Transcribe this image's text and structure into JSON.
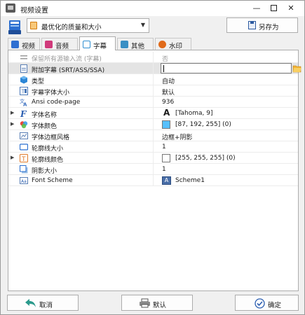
{
  "window": {
    "title": "视频设置"
  },
  "toolbar": {
    "preset_value": "最优化的质量和大小",
    "saveas_label": "另存为"
  },
  "tabs": [
    {
      "label": "视频",
      "color": "#2f6fd1"
    },
    {
      "label": "音频",
      "color": "#d03a7b"
    },
    {
      "label": "字幕",
      "color": "#2f8fd1"
    },
    {
      "label": "其他",
      "color": "#3a8fc4"
    },
    {
      "label": "水印",
      "color": "#e06a1a"
    }
  ],
  "active_tab": "字幕",
  "properties": [
    {
      "name": "保留所有源输入流 (字幕)",
      "value": "否",
      "disabled": true,
      "icon": "stream-icon"
    },
    {
      "name": "附加字幕 (SRT/ASS/SSA)",
      "value": "",
      "selected": true,
      "icon": "subtitle-file-icon"
    },
    {
      "name": "类型",
      "value": "自动",
      "icon": "cube-icon"
    },
    {
      "name": "字幕字体大小",
      "value": "默认",
      "icon": "font-size-icon"
    },
    {
      "name": "Ansi code-page",
      "value": "936",
      "icon": "translate-icon"
    },
    {
      "name": "字体名称",
      "value": "[Tahoma, 9]",
      "expandable": true,
      "icon": "font-icon"
    },
    {
      "name": "字体颜色",
      "value": "[87, 192, 255] (0)",
      "expandable": true,
      "icon": "color-icon",
      "swatch": "#57c0ff"
    },
    {
      "name": "字体边框风格",
      "value": "边框+阴影",
      "icon": "border-style-icon"
    },
    {
      "name": "轮廓线大小",
      "value": "1",
      "icon": "outline-size-icon"
    },
    {
      "name": "轮廓线颜色",
      "value": "[255, 255, 255] (0)",
      "expandable": true,
      "icon": "outline-color-icon",
      "swatch": "#ffffff"
    },
    {
      "name": "阴影大小",
      "value": "1",
      "icon": "shadow-icon"
    },
    {
      "name": "Font Scheme",
      "value": "Scheme1",
      "icon": "font-scheme-icon"
    }
  ],
  "buttons": {
    "cancel": "取消",
    "default": "默认",
    "ok": "确定"
  }
}
